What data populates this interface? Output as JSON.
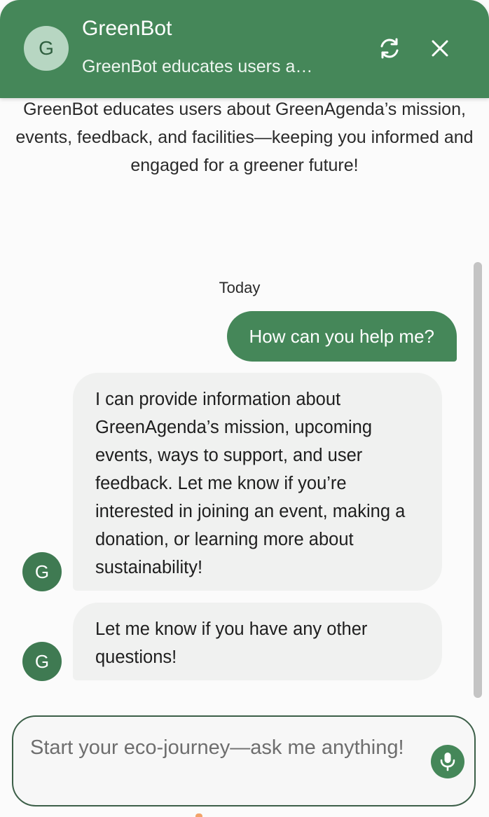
{
  "header": {
    "avatar_letter": "G",
    "bot_name": "GreenBot",
    "subtitle": "GreenBot educates users a…",
    "refresh_icon": "refresh-icon",
    "close_icon": "close-icon",
    "background_color": "#458759"
  },
  "intro": {
    "text": "GreenBot educates users about GreenAgenda’s mission, events, feedback, and facilities—keeping you informed and engaged for a greener future!"
  },
  "conversation": {
    "date_label": "Today",
    "messages": [
      {
        "sender": "user",
        "text": "How can you help me?"
      },
      {
        "sender": "bot",
        "avatar_letter": "G",
        "text": "I can provide information about GreenAgenda’s mission, upcoming events, ways to support, and user feedback. Let me know if you’re interested in joining an event, making a donation, or learning more about sustainability!"
      },
      {
        "sender": "bot",
        "avatar_letter": "G",
        "text": "Let me know if you have any other questions!"
      }
    ]
  },
  "composer": {
    "placeholder": "Start your eco-journey—ask me anything!",
    "mic_icon": "microphone-icon"
  }
}
